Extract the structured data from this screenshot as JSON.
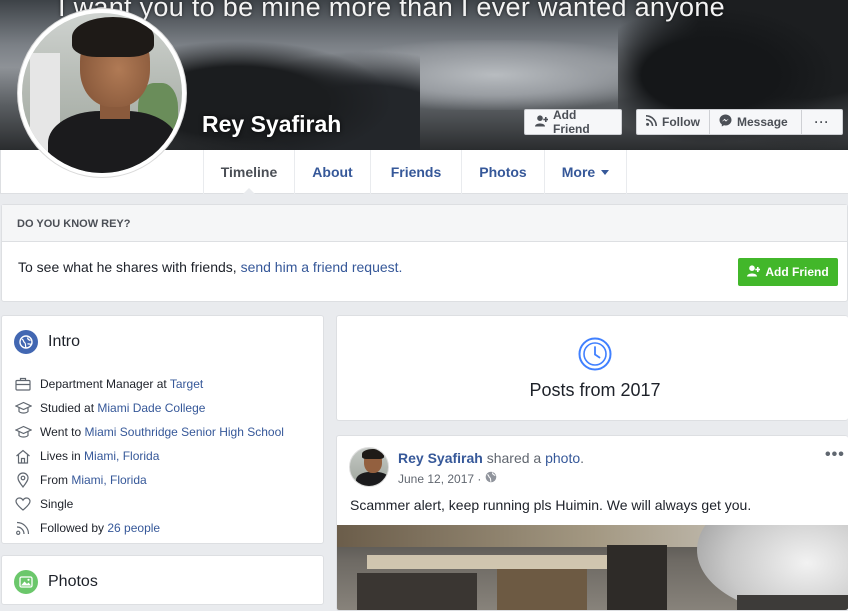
{
  "cover": {
    "quote": "I want you to be mine more than I ever wanted anyone",
    "name": "Rey Syafirah",
    "add_friend_label": "Add Friend",
    "follow_label": "Follow",
    "message_label": "Message",
    "more_label": "···"
  },
  "nav": {
    "tabs": [
      {
        "label": "Timeline",
        "active": true
      },
      {
        "label": "About"
      },
      {
        "label": "Friends"
      },
      {
        "label": "Photos"
      },
      {
        "label": "More"
      }
    ]
  },
  "know": {
    "header": "DO YOU KNOW REY?",
    "text": "To see what he shares with friends, ",
    "link": "send him a friend request.",
    "button_label": "Add Friend"
  },
  "intro": {
    "title": "Intro",
    "items": [
      {
        "icon": "briefcase-icon",
        "prefix": "Department Manager at ",
        "link": "Target",
        "suffix": ""
      },
      {
        "icon": "graduation-cap-icon",
        "prefix": "Studied at ",
        "link": "Miami Dade College",
        "suffix": ""
      },
      {
        "icon": "graduation-cap-icon",
        "prefix": "Went to ",
        "link": "Miami Southridge Senior High School",
        "suffix": ""
      },
      {
        "icon": "home-icon",
        "prefix": "Lives in ",
        "link": "Miami, Florida",
        "suffix": ""
      },
      {
        "icon": "location-pin-icon",
        "prefix": "From ",
        "link": "Miami, Florida",
        "suffix": ""
      },
      {
        "icon": "heart-icon",
        "prefix": "Single",
        "link": "",
        "suffix": ""
      },
      {
        "icon": "rss-icon",
        "prefix": "Followed by ",
        "link": "26 people",
        "suffix": ""
      }
    ]
  },
  "photos_card": {
    "title": "Photos"
  },
  "year_card": {
    "title": "Posts from 2017"
  },
  "post": {
    "author": "Rey Syafirah",
    "action": " shared a ",
    "object": "photo",
    "trail": ".",
    "date": "June 12, 2017 ·",
    "text": "Scammer alert, keep running pls Huimin. We will always get you.",
    "menu": "•••"
  },
  "colors": {
    "link": "#365899",
    "green_button": "#42b72a",
    "intro_icon_bg": "#4267b2",
    "photos_icon_bg": "#6bc76b",
    "clock": "#4080ff"
  }
}
